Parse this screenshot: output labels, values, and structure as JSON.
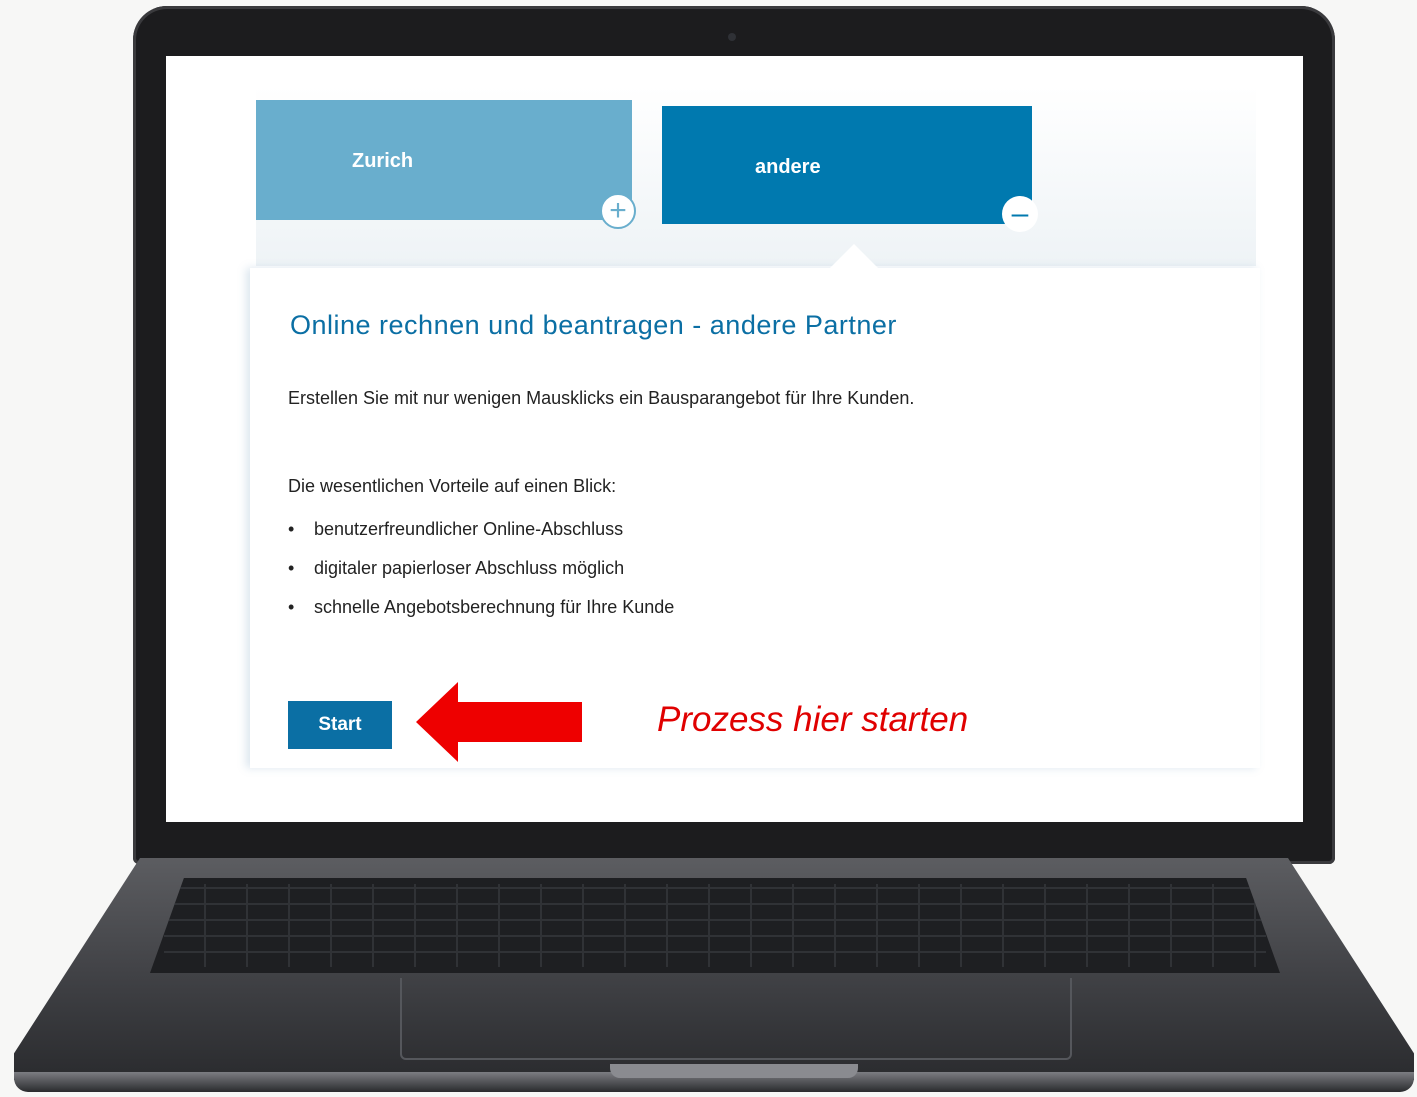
{
  "tabs": [
    {
      "label": "Zurich",
      "state": "collapsed",
      "icon": "plus-icon",
      "color": "#69aecd"
    },
    {
      "label": "andere",
      "state": "expanded",
      "icon": "minus-icon",
      "color": "#0079af"
    }
  ],
  "panel": {
    "title": "Online rechnen und beantragen - andere Partner",
    "intro": "Erstellen Sie mit nur wenigen Mausklicks ein Bausparangebot für Ihre Kunden.",
    "benefits_heading": "Die wesentlichen Vorteile auf einen Blick:",
    "benefits": [
      "benutzerfreundlicher Online-Abschluss",
      "digitaler papierloser Abschluss möglich",
      "schnelle Angebotsberechnung für Ihre Kunde"
    ],
    "bullet": "•",
    "start_label": "Start"
  },
  "annotation": {
    "callout": "Prozess hier starten",
    "arrow_icon": "arrow-left-icon",
    "color": "#e00000"
  },
  "colors": {
    "primary": "#0b6fa4",
    "tab_light": "#69aecd",
    "tab_dark": "#0079af"
  }
}
